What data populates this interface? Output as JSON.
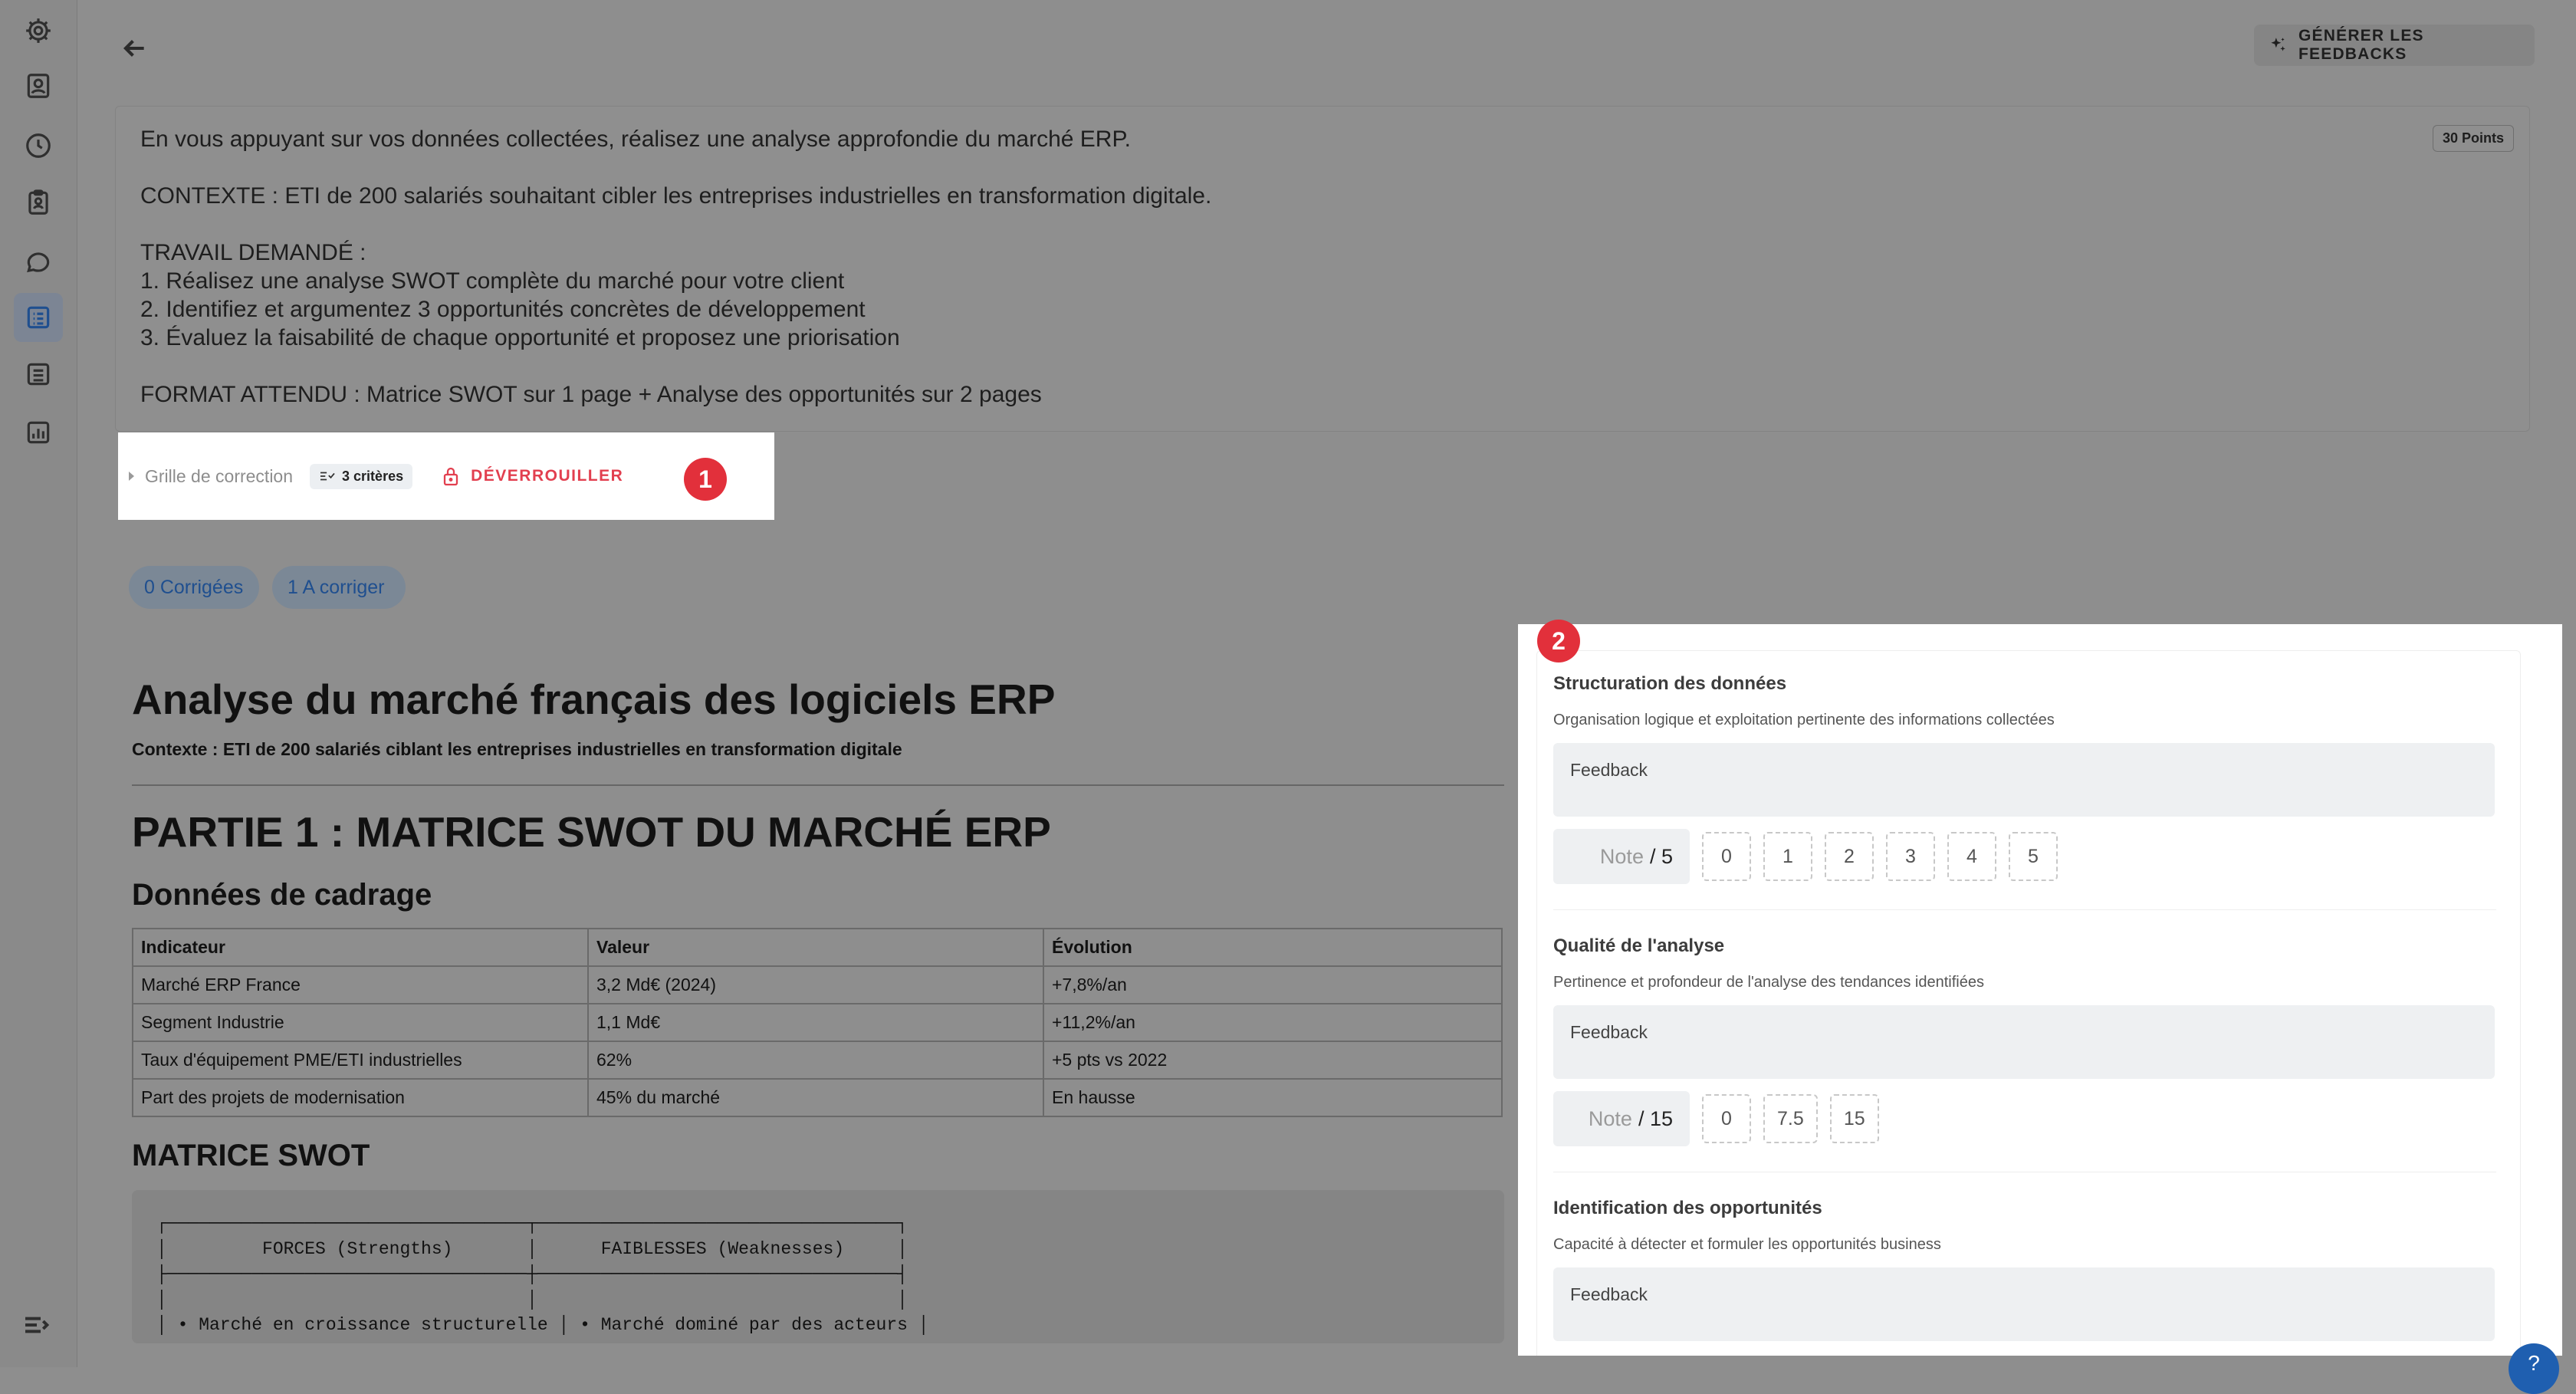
{
  "sidebar": {
    "items": [
      {
        "icon": "settings-icon"
      },
      {
        "icon": "contact-card-icon"
      },
      {
        "icon": "clock-icon"
      },
      {
        "icon": "clipboard-user-icon"
      },
      {
        "icon": "chat-bubble-icon"
      },
      {
        "icon": "assignment-list-icon",
        "active": true
      },
      {
        "icon": "list-icon"
      },
      {
        "icon": "bar-chart-icon"
      }
    ],
    "collapse_icon": "menu-collapse-icon"
  },
  "header": {
    "back_icon": "arrow-left-icon",
    "generate_label": "GÉNÉRER LES FEEDBACKS",
    "generate_icon": "sparkle-icon"
  },
  "instructions": {
    "points": "30 Points",
    "lines": {
      "l1": "En vous appuyant sur vos données collectées, réalisez une analyse approfondie du marché ERP.",
      "l2": "CONTEXTE : ETI de 200 salariés souhaitant cibler les entreprises industrielles en transformation digitale.",
      "l3": "TRAVAIL DEMANDÉ :",
      "l4": "1. Réalisez une analyse SWOT complète du marché pour votre client",
      "l5": "2. Identifiez et argumentez 3 opportunités concrètes de développement",
      "l6": "3. Évaluez la faisabilité de chaque opportunité et proposez une priorisation",
      "l7": "FORMAT ATTENDU : Matrice SWOT sur 1 page + Analyse des opportunités sur 2 pages"
    }
  },
  "grille": {
    "label": "Grille de correction",
    "criteria_badge": "3 critères",
    "unlock_label": "DÉVERROUILLER",
    "marker": "1"
  },
  "status": {
    "corrected": "0 Corrigées",
    "to_correct": "1 A corriger"
  },
  "document": {
    "title": "Analyse du marché français des logiciels ERP",
    "context": "Contexte : ETI de 200 salariés ciblant les entreprises industrielles en transformation digitale",
    "part1": "PARTIE 1 : MATRICE SWOT DU MARCHÉ ERP",
    "section_cadrage": "Données de cadrage",
    "table": {
      "headers": {
        "h1": "Indicateur",
        "h2": "Valeur",
        "h3": "Évolution"
      },
      "rows": {
        "r1": {
          "c1": "Marché ERP France",
          "c2": "3,2 Md€ (2024)",
          "c3": "+7,8%/an"
        },
        "r2": {
          "c1": "Segment Industrie",
          "c2": "1,1 Md€",
          "c3": "+11,2%/an"
        },
        "r3": {
          "c1": "Taux d'équipement PME/ETI industrielles",
          "c2": "62%",
          "c3": "+5 pts vs 2022"
        },
        "r4": {
          "c1": "Part des projets de modernisation",
          "c2": "45% du marché",
          "c3": "En hausse"
        }
      }
    },
    "section_swot": "MATRICE SWOT",
    "swot_ascii": "┌──────────────────────────────────┬──────────────────────────────────┐\n│         FORCES (Strengths)       │      FAIBLESSES (Weaknesses)     │\n├──────────────────────────────────┼──────────────────────────────────┤\n│                                  │                                  │\n│ • Marché en croissance structurelle │ • Marché dominé par des acteurs │"
  },
  "panel": {
    "marker": "2",
    "feedback_placeholder": "Feedback",
    "note_label": "Note",
    "criteria": {
      "c1": {
        "title": "Structuration des données",
        "desc": "Organisation logique et exploitation pertinente des informations collectées",
        "max": "/ 5",
        "options": [
          "0",
          "1",
          "2",
          "3",
          "4",
          "5"
        ]
      },
      "c2": {
        "title": "Qualité de l'analyse",
        "desc": "Pertinence et profondeur de l'analyse des tendances identifiées",
        "max": "/ 15",
        "options": [
          "0",
          "7.5",
          "15"
        ]
      },
      "c3": {
        "title": "Identification des opportunités",
        "desc": "Capacité à détecter et formuler les opportunités business"
      }
    }
  },
  "help_label": "?"
}
